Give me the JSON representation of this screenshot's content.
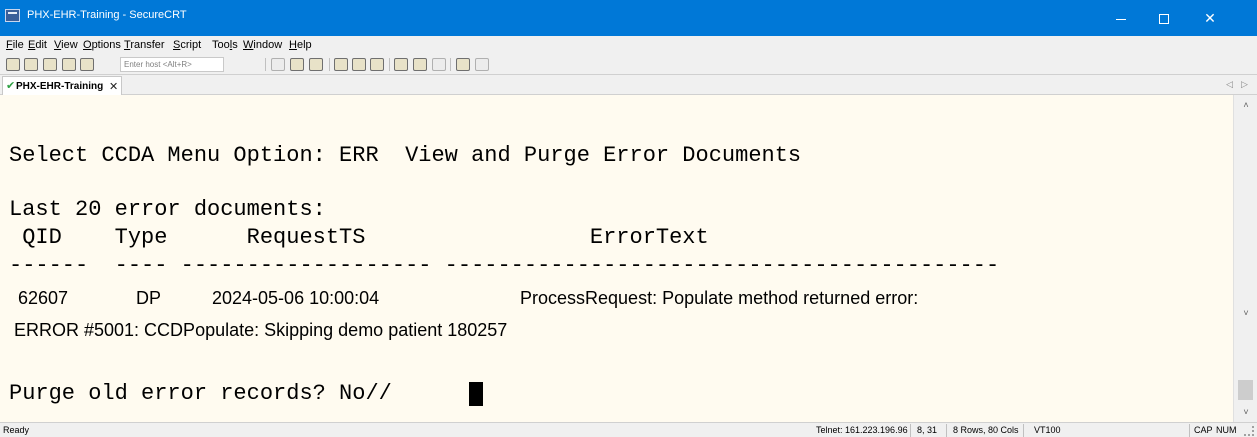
{
  "window": {
    "title": "PHX-EHR-Training - SecureCRT",
    "controls": {
      "minimize_icon": "minimize-icon",
      "maximize_icon": "maximize-icon",
      "close_label": "✕"
    }
  },
  "menu": [
    {
      "key": "F",
      "rest": "ile"
    },
    {
      "key": "E",
      "rest": "dit"
    },
    {
      "key": "V",
      "rest": "iew"
    },
    {
      "key": "O",
      "rest": "ptions"
    },
    {
      "key": "T",
      "rest": "ransfer"
    },
    {
      "key": "S",
      "rest": "cript"
    },
    {
      "pre": "Too",
      "key": "l",
      "rest": "s"
    },
    {
      "key": "W",
      "rest": "indow"
    },
    {
      "key": "H",
      "rest": "elp"
    }
  ],
  "toolbar": {
    "host_placeholder": "Enter host <Alt+R>"
  },
  "tabs": [
    {
      "label": "PHX-EHR-Training",
      "close": "✕",
      "status_icon": "check-icon"
    }
  ],
  "tab_nav": {
    "prev": "◁",
    "next": "▷"
  },
  "terminal": {
    "prompt_line": "Select CCDA Menu Option: ERR  View and Purge Error Documents",
    "header_line": "Last 20 error documents:",
    "column_line": " QID    Type      RequestTS                 ErrorText",
    "separator_line": "------  ---- ------------------- ------------------------------------------",
    "row": {
      "qid": "62607",
      "type": "DP",
      "request_ts": "2024-05-06 10:00:04",
      "error_text": "ProcessRequest: Populate method returned error:"
    },
    "error_detail": "ERROR #5001: CCDPopulate: Skipping demo patient 180257",
    "purge_prompt": "Purge old error records? No//"
  },
  "statusbar": {
    "status": "Ready",
    "connection": "Telnet: 161.223.196.96",
    "cursor_pos": "8, 31",
    "size": "8 Rows, 80 Cols",
    "emulation": "VT100",
    "caps": "CAP",
    "num": "NUM"
  }
}
